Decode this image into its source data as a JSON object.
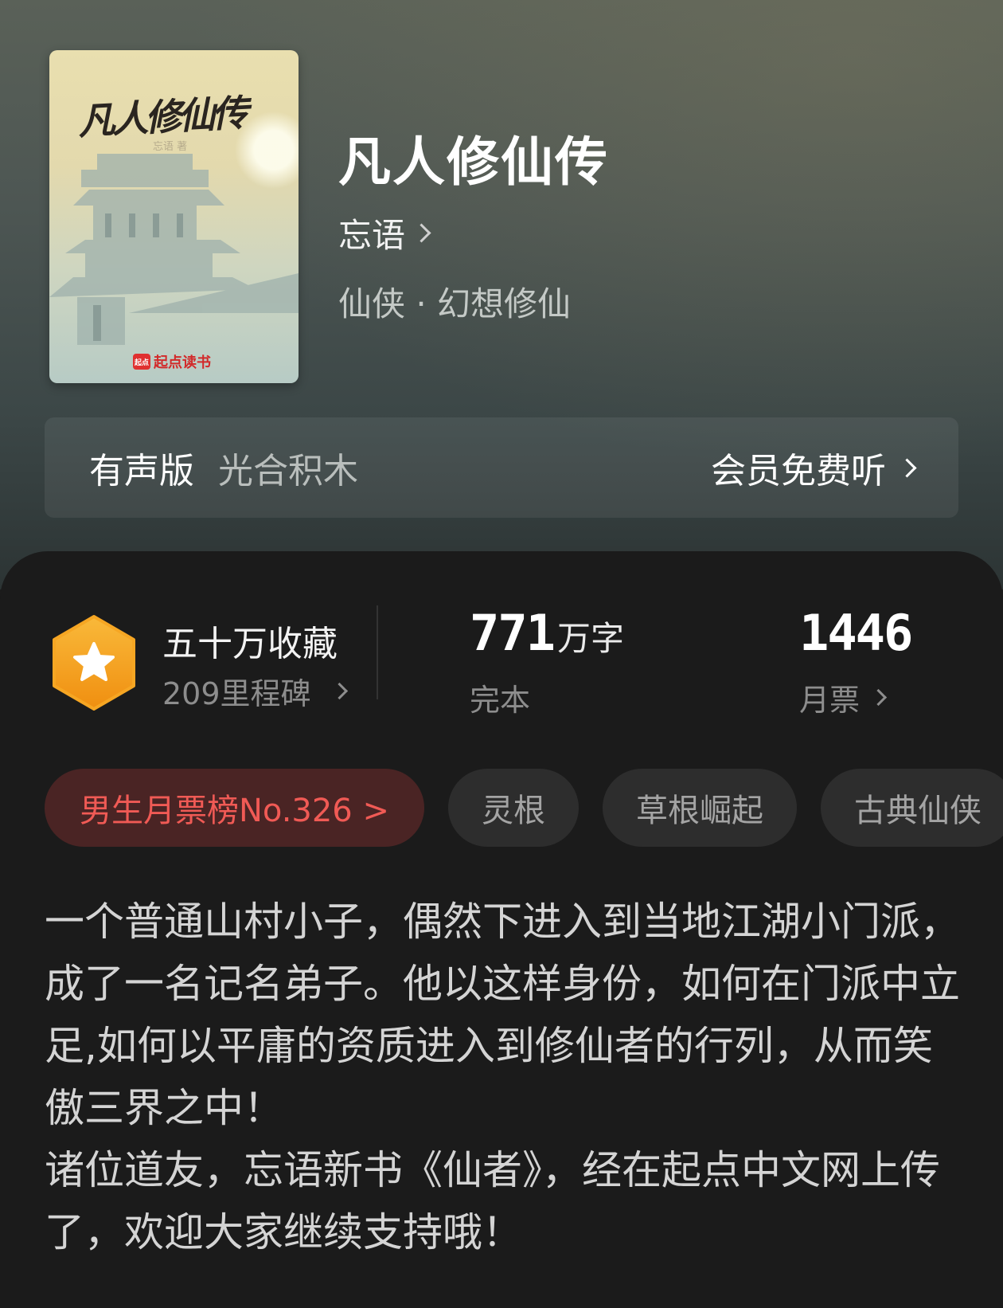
{
  "book": {
    "title": "凡人修仙传",
    "author": "忘语",
    "genre": "仙侠 · 幻想修仙",
    "cover": {
      "title": "凡人修仙传",
      "subtitle": "忘语 著",
      "brand_logo": "起点",
      "brand": "起点读书"
    }
  },
  "audio": {
    "label": "有声版",
    "studio": "光合积木",
    "action": "会员免费听"
  },
  "stats": {
    "favorites_title": "五十万收藏",
    "milestones": "209里程碑",
    "word_count": "771",
    "word_unit": "万字",
    "status": "完本",
    "monthly_tickets": "1446",
    "monthly_label": "月票"
  },
  "tags": [
    "男生月票榜No.326 >",
    "灵根",
    "草根崛起",
    "古典仙侠"
  ],
  "description": "一个普通山村小子，偶然下进入到当地江湖小门派，成了一名记名弟子。他以这样身份，如何在门派中立足,如何以平庸的资质进入到修仙者的行列，从而笑傲三界之中！\n诸位道友，忘语新书《仙者》，经在起点中文网上传了，欢迎大家继续支持哦！",
  "colors": {
    "accent_red": "#f05a55",
    "badge_orange": "#f6a623",
    "background_dark": "#1b1b1b"
  },
  "icons": [
    "star-badge-icon",
    "chevron-right-icon"
  ]
}
